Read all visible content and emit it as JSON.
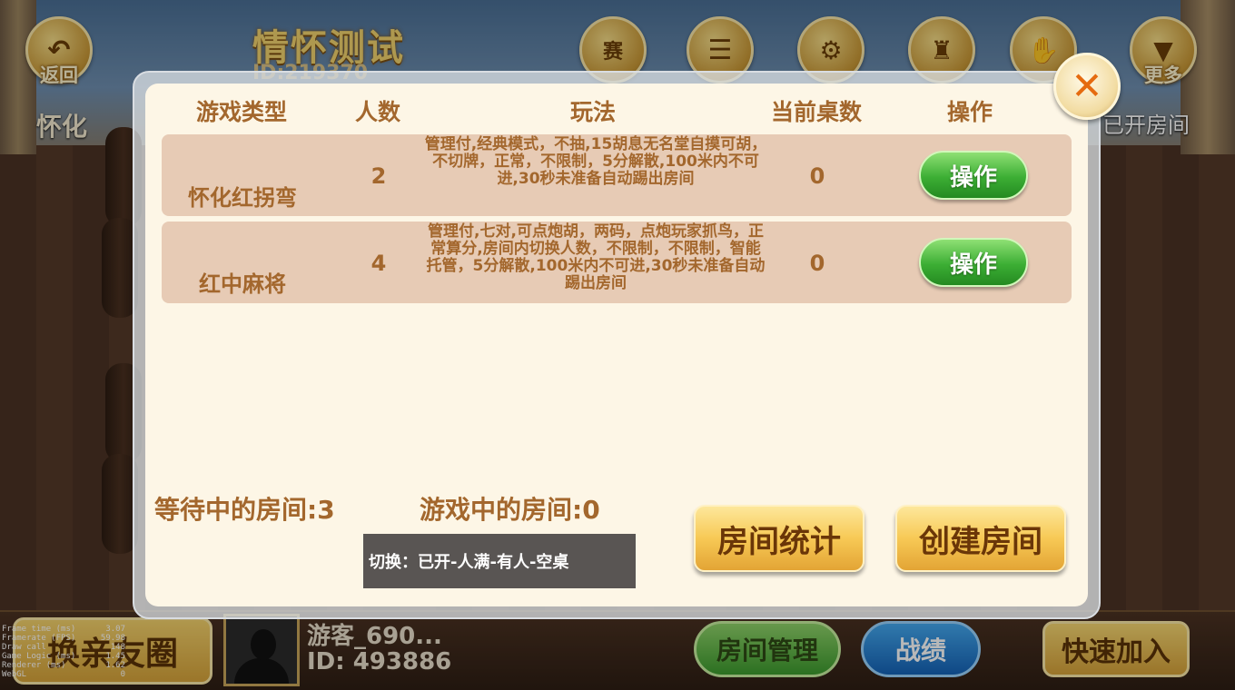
{
  "header": {
    "back_label": "返回",
    "club_name": "情怀测试",
    "club_id": "ID:219370",
    "city": "怀化",
    "more_label": "更多",
    "opened_rooms_label": "已开房间",
    "match_icon_text": "赛"
  },
  "dialog": {
    "columns": [
      "游戏类型",
      "人数",
      "玩法",
      "当前桌数",
      "操作"
    ],
    "rows": [
      {
        "game_type": "怀化红拐弯",
        "players": "2",
        "rules": "管理付,经典模式，不抽,15胡息无名堂自摸可胡，不切牌，正常，不限制，5分解散,100米内不可进,30秒未准备自动踢出房间",
        "tables": "0",
        "action": "操作"
      },
      {
        "game_type": "红中麻将",
        "players": "4",
        "rules": "管理付,七对,可点炮胡，两码，点炮玩家抓鸟，正常算分,房间内切换人数，不限制，不限制，智能托管，5分解散,100米内不可进,30秒未准备自动踢出房间",
        "tables": "0",
        "action": "操作"
      }
    ],
    "waiting_rooms": "等待中的房间:3",
    "playing_rooms": "游戏中的房间:0",
    "toggle_text": "切换：已开-人满-有人-空桌",
    "room_stats_label": "房间统计",
    "create_room_label": "创建房间",
    "close_symbol": "✕"
  },
  "bottom": {
    "friend_circle_label": "换亲友圈",
    "user_name": "游客_690...",
    "user_id": "ID: 493886",
    "room_manage_label": "房间管理",
    "records_label": "战绩",
    "quick_join_label": "快速加入"
  },
  "debug": [
    {
      "label": "Frame time (ms)",
      "value": "3.07"
    },
    {
      "label": "Framerate (FPS)",
      "value": "59.98"
    },
    {
      "label": "Draw call",
      "value": "148"
    },
    {
      "label": "Game Logic (ms)",
      "value": "1.45"
    },
    {
      "label": "Renderer (ms)",
      "value": "1.62"
    },
    {
      "label": "WebGL",
      "value": "0"
    }
  ]
}
